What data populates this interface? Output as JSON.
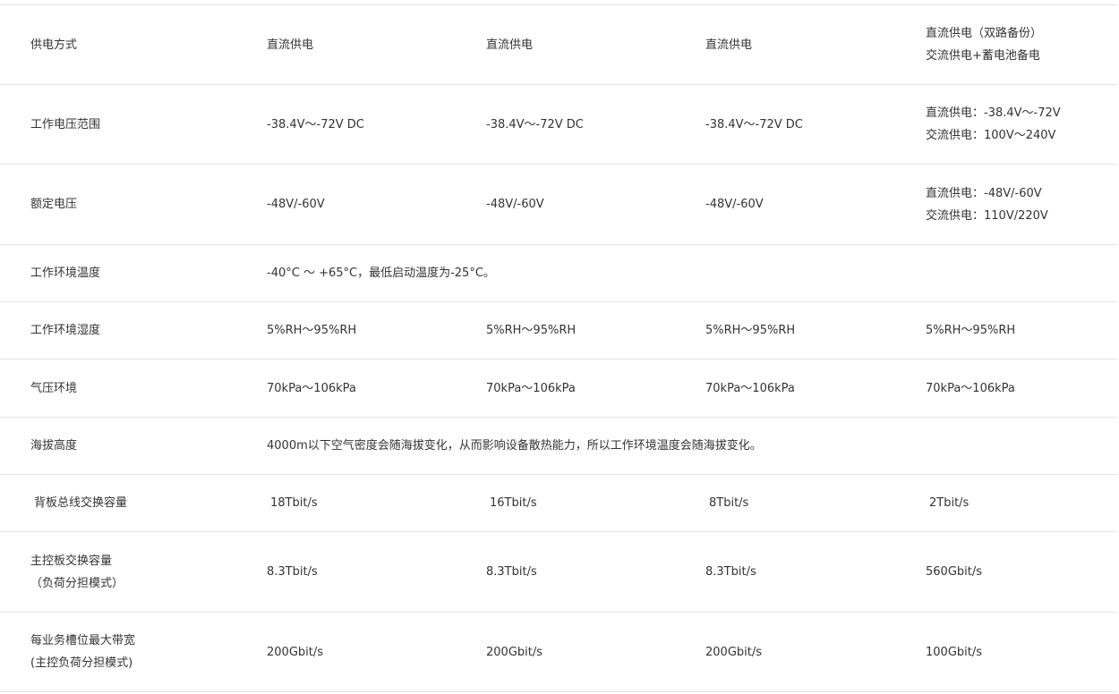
{
  "rows": [
    {
      "label": "供电方式",
      "col1": "直流供电",
      "col2": "直流供电",
      "col3": "直流供电",
      "col4_line1": "直流供电（双路备份）",
      "col4_line2": "交流供电+蓄电池备电"
    },
    {
      "label": "工作电压范围",
      "col1": "-38.4V～-72V DC",
      "col2": "-38.4V～-72V DC",
      "col3": "-38.4V～-72V DC",
      "col4_line1": "直流供电：-38.4V～-72V",
      "col4_line2": "交流供电：100V～240V"
    },
    {
      "label": "额定电压",
      "col1": "-48V/-60V",
      "col2": "-48V/-60V",
      "col3": "-48V/-60V",
      "col4_line1": "直流供电：-48V/-60V",
      "col4_line2": "交流供电：110V/220V"
    },
    {
      "label": "工作环境温度",
      "merged": "-40°C ～ +65°C，最低启动温度为-25°C。"
    },
    {
      "label": "工作环境湿度",
      "col1": "5%RH～95%RH",
      "col2": "5%RH～95%RH",
      "col3": "5%RH～95%RH",
      "col4": "5%RH～95%RH"
    },
    {
      "label": "气压环境",
      "col1": "70kPa～106kPa",
      "col2": "70kPa～106kPa",
      "col3": "70kPa～106kPa",
      "col4": "70kPa～106kPa"
    },
    {
      "label": "海拔高度",
      "merged": "4000m以下空气密度会随海拔变化，从而影响设备散热能力，所以工作环境温度会随海拔变化。"
    },
    {
      "label": "背板总线交换容量",
      "col1": "18Tbit/s",
      "col2": "16Tbit/s",
      "col3": "8Tbit/s",
      "col4": "2Tbit/s"
    },
    {
      "label_line1": "主控板交换容量",
      "label_line2": "（负荷分担模式）",
      "col1": "8.3Tbit/s",
      "col2": "8.3Tbit/s",
      "col3": "8.3Tbit/s",
      "col4": "560Gbit/s"
    },
    {
      "label_line1": "每业务槽位最大带宽",
      "label_line2": "(主控负荷分担模式)",
      "col1": "200Gbit/s",
      "col2": "200Gbit/s",
      "col3": "200Gbit/s",
      "col4": "100Gbit/s"
    }
  ]
}
